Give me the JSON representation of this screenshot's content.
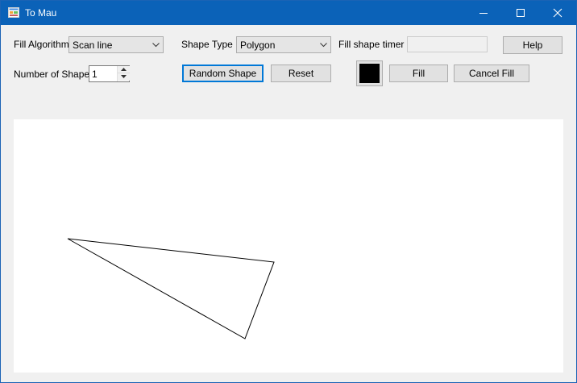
{
  "window": {
    "title": "To Mau"
  },
  "toolbar": {
    "fill_algorithm_label": "Fill Algorithm",
    "fill_algorithm_value": "Scan line",
    "shape_type_label": "Shape Type",
    "shape_type_value": "Polygon",
    "fill_shape_timer_label": "Fill shape timer",
    "fill_shape_timer_value": "",
    "help_label": "Help",
    "number_of_shape_label": "Number of Shape",
    "number_of_shape_value": "1",
    "random_shape_label": "Random Shape",
    "reset_label": "Reset",
    "fill_label": "Fill",
    "cancel_fill_label": "Cancel Fill",
    "fill_color": "#000000"
  },
  "colors": {
    "titlebar": "#0b62b8",
    "window_bg": "#f0f0f0",
    "canvas_bg": "#ffffff",
    "accent": "#0078d7"
  },
  "icons": {
    "app": "app-icon",
    "minimize": "minimize-icon",
    "maximize": "maximize-icon",
    "close": "close-icon",
    "dropdown": "chevron-down-icon",
    "spin_up": "arrow-up-icon",
    "spin_down": "arrow-down-icon"
  }
}
